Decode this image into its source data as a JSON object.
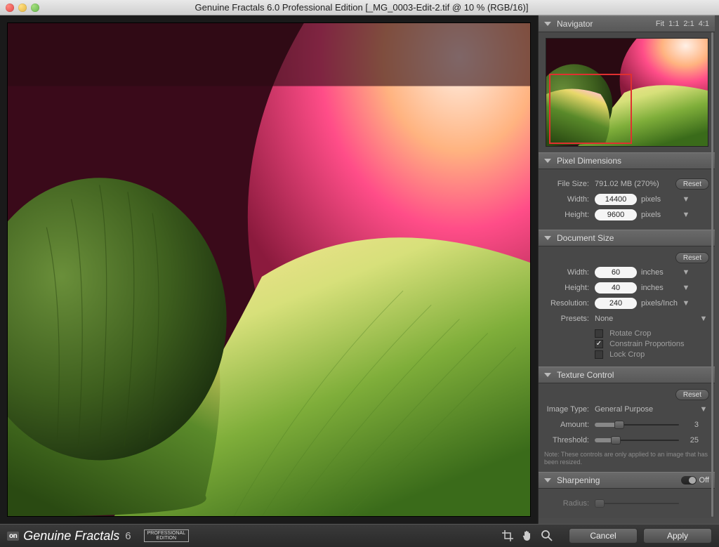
{
  "window": {
    "title": "Genuine Fractals 6.0 Professional Edition [_MG_0003-Edit-2.tif @ 10 % (RGB/16)]"
  },
  "panels": {
    "navigator": {
      "title": "Navigator",
      "zoom": {
        "fit": "Fit",
        "z11": "1:1",
        "z21": "2:1",
        "z41": "4:1"
      }
    },
    "pixeldimensions": {
      "title": "Pixel Dimensions",
      "filesize_label": "File Size:",
      "filesize_value": "791.02 MB (270%)",
      "reset": "Reset",
      "width_label": "Width:",
      "width_value": "14400",
      "width_unit": "pixels",
      "height_label": "Height:",
      "height_value": "9600",
      "height_unit": "pixels"
    },
    "documentsize": {
      "title": "Document Size",
      "reset": "Reset",
      "width_label": "Width:",
      "width_value": "60",
      "width_unit": "inches",
      "height_label": "Height:",
      "height_value": "40",
      "height_unit": "inches",
      "resolution_label": "Resolution:",
      "resolution_value": "240",
      "resolution_unit": "pixels/Inch",
      "presets_label": "Presets:",
      "presets_value": "None",
      "rotate_crop": "Rotate Crop",
      "constrain": "Constrain Proportions",
      "lock_crop": "Lock Crop"
    },
    "texture": {
      "title": "Texture Control",
      "reset": "Reset",
      "imagetype_label": "Image Type:",
      "imagetype_value": "General Purpose",
      "amount_label": "Amount:",
      "amount_value": "3",
      "threshold_label": "Threshold:",
      "threshold_value": "25",
      "note": "Note: These controls are only applied to an image that has been resized."
    },
    "sharpening": {
      "title": "Sharpening",
      "off": "Off",
      "radius_label": "Radius:"
    }
  },
  "footer": {
    "brand_on": "on",
    "brand_name": "Genuine Fractals",
    "brand_version": "6",
    "edition_top": "PROFESSIONAL",
    "edition_bot": "EDITION",
    "cancel": "Cancel",
    "apply": "Apply"
  },
  "chevron": "▼"
}
